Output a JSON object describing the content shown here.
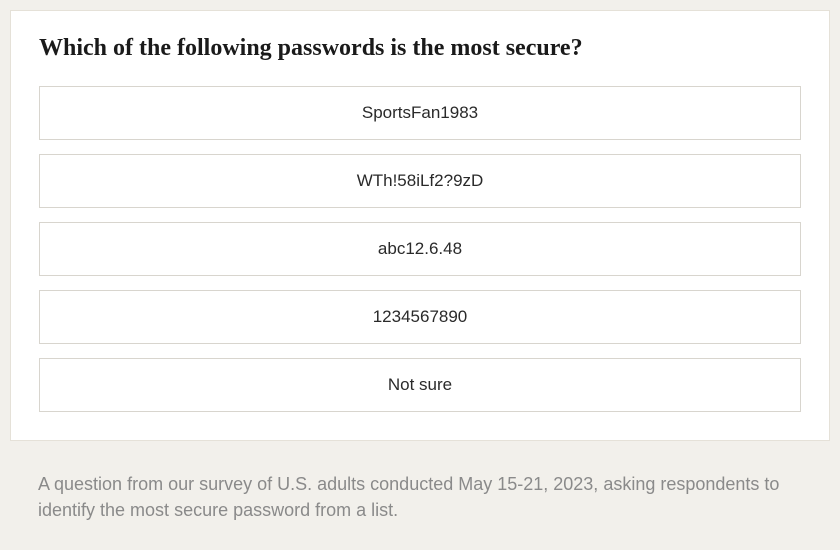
{
  "quiz": {
    "question": "Which of the following passwords is the most secure?",
    "options": [
      "SportsFan1983",
      "WTh!58iLf2?9zD",
      "abc12.6.48",
      "1234567890",
      "Not sure"
    ]
  },
  "caption": "A question from our survey of U.S. adults conducted May 15-21, 2023, asking respondents to identify the most secure password from a list."
}
